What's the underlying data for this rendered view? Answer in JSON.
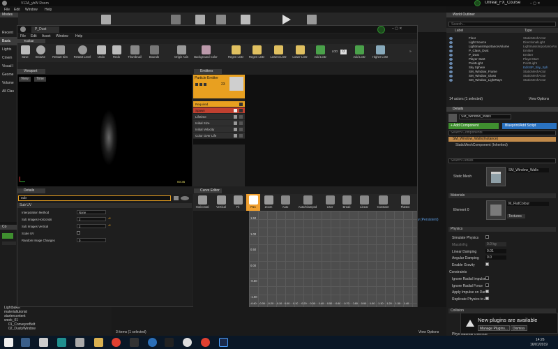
{
  "main": {
    "title": "V12A_ybW Room",
    "menu": [
      "File",
      "Edit",
      "Window",
      "Help"
    ],
    "project_name": "Unreal_FX_Course",
    "modes_tab": "Modes",
    "modes_items": [
      "Recent",
      "Basic",
      "Lights",
      "Cinem",
      "Visual I",
      "Geome",
      "Volume",
      "All Clas"
    ]
  },
  "cascade": {
    "tab": "P_Dust",
    "menu": [
      "File",
      "Edit",
      "Asset",
      "Window",
      "Help"
    ],
    "toolbar_tab": "Toolbar",
    "toolbar": [
      "Save",
      "Browse",
      "Restart Sim",
      "Restart Level",
      "Undo",
      "Redo",
      "Thumbnail",
      "Bounds",
      "Origin Axis",
      "Background Color",
      "Regen LOD",
      "Regen LOD",
      "Lowest LOD",
      "Lower LOD",
      "Add LOD",
      "LOD",
      "Add LOD",
      "Higher LOD"
    ],
    "lod_value": "0",
    "viewport_tab": "Viewport",
    "viewport_buttons": [
      "View",
      "Time"
    ],
    "viewport_fps": "00:35",
    "emitters_tab": "Emitters",
    "emitter_name": "Particle Emitter",
    "emitter_count": "23",
    "modules": [
      "Required",
      "Spawn",
      "Lifetime",
      "Initial Size",
      "Initial Velocity",
      "Color Over Life"
    ],
    "details_tab": "Details",
    "details_search": "sub",
    "sub_uv": {
      "header": "Sub UV",
      "rows": [
        {
          "label": "Interpolation Method",
          "value": "None"
        },
        {
          "label": "Sub Images Horizontal",
          "value": "2"
        },
        {
          "label": "Sub Images Vertical",
          "value": "2"
        },
        {
          "label": "Scale UV",
          "value": ""
        },
        {
          "label": "Random Image Changes",
          "value": "0"
        }
      ]
    },
    "curve_tab": "Curve Editor",
    "curve_toolbar": [
      "Horizontal",
      "Vertical",
      "Fit",
      "Pan",
      "Zoom",
      "Auto",
      "Auto/Clamped",
      "User",
      "Break",
      "Linear",
      "Constant",
      "Flatten"
    ],
    "curve_y_labels": [
      "1.50",
      "1.00",
      "0.50",
      "0.00",
      "-0.50",
      "-1.00"
    ],
    "curve_x_labels": [
      "-0.40",
      "-0.30",
      "-0.20",
      "-0.10",
      "0.00",
      "0.10",
      "0.20",
      "0.30",
      "0.40",
      "0.50",
      "0.60",
      "0.70",
      "0.80",
      "0.90",
      "1.00",
      "1.10",
      "1.20",
      "1.30",
      "1.40"
    ]
  },
  "outliner": {
    "tab": "World Outliner",
    "search_placeholder": "Search...",
    "col_label": "Label",
    "col_type": "Type",
    "rows": [
      {
        "label": "Floor",
        "type": "StaticMeshActor"
      },
      {
        "label": "Light Source",
        "type": "DirectionalLight"
      },
      {
        "label": "LightmassImportanceVolume",
        "type": "LightmassImportanceVolu"
      },
      {
        "label": "P_Class_Dust",
        "type": "Emitter"
      },
      {
        "label": "P_Dust",
        "type": "Emitter"
      },
      {
        "label": "Player Start",
        "type": "PlayerStart"
      },
      {
        "label": "PointLight",
        "type": "PointLight"
      },
      {
        "label": "Sky Sphere",
        "type": "Edit BP_Sky_Sph"
      },
      {
        "label": "SM_Window_Frame",
        "type": "StaticMeshActor"
      },
      {
        "label": "SM_Window_Glass",
        "type": "StaticMeshActor"
      },
      {
        "label": "SM_Window_LightRays",
        "type": "StaticMeshActor"
      }
    ],
    "status": "14 actors (1 selected)",
    "view_options": "View Options"
  },
  "details_right": {
    "tab": "Details",
    "name_value": "SM_Window_Walls",
    "add_component": "+ Add Component",
    "blueprint_button": "Blueprint/Add Script",
    "search_components": "Search Components",
    "component_instance": "SM_Window_Walls(Instance)",
    "component_static": "StaticMeshComponent (Inherited)",
    "search_details": "Search Details",
    "static_mesh_label": "Static Mesh",
    "static_mesh_value": "SM_Window_Walls",
    "materials_header": "Materials",
    "element0_label": "Element 0",
    "element0_value": "M_FlatColour",
    "textures_btn": "Textures",
    "physics_header": "Physics",
    "physics_rows": [
      {
        "label": "Simulate Physics",
        "value": ""
      },
      {
        "label": "MassInKg",
        "value": "0.0 kg"
      },
      {
        "label": "Linear Damping",
        "value": "0.01"
      },
      {
        "label": "Angular Damping",
        "value": "0.0"
      },
      {
        "label": "Enable Gravity",
        "value": ""
      },
      {
        "label": "Constraints",
        "value": ""
      },
      {
        "label": "Ignore Radial Impulse",
        "value": ""
      },
      {
        "label": "Ignore Radial Force",
        "value": ""
      },
      {
        "label": "Apply Impulse on Dam",
        "value": ""
      },
      {
        "label": "Replicate Physics to A",
        "value": ""
      }
    ],
    "collision_header": "Collision",
    "collision_preset": "Phys Material Override",
    "persistent_label": "w (Persistent)"
  },
  "content_browser": {
    "tab": "Co",
    "folders": [
      "Lightbaker",
      "materialtutorial",
      "startercontent",
      "week_01",
      "01_ConveyorBelt",
      "02_DustyWindow"
    ],
    "status": "3 items (1 selected)",
    "view_options": "View Options"
  },
  "notification": {
    "title": "New plugins are available",
    "manage": "Manage Plugins...",
    "dismiss": "Dismiss"
  },
  "taskbar": {
    "time": "14:26",
    "date": "16/01/2019"
  },
  "colors": {
    "accent_orange": "#e8a020",
    "spawn_red": "#c04030",
    "pan_orange": "#f0a030",
    "blueprint_blue": "#2a72c0",
    "add_green": "#3f8f2f"
  }
}
